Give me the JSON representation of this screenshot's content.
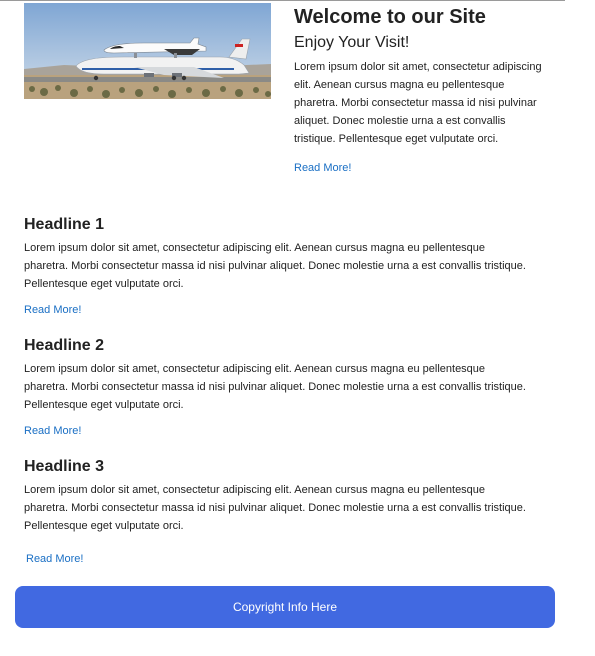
{
  "hero": {
    "image_alt": "Space shuttle on a carrier aircraft",
    "title": "Welcome to our Site",
    "subtitle": "Enjoy Your Visit!",
    "body": "Lorem ipsum dolor sit amet, consectetur adipiscing elit. Aenean cursus magna eu pellentesque pharetra. Morbi consectetur massa id nisi pulvinar aliquet. Donec molestie urna a est convallis tristique. Pellentesque eget vulputate orci.",
    "read_more": "Read More!"
  },
  "articles": [
    {
      "headline": "Headline 1",
      "body": "Lorem ipsum dolor sit amet, consectetur adipiscing elit. Aenean cursus magna eu pellentesque pharetra. Morbi consectetur massa id nisi pulvinar aliquet. Donec molestie urna a est convallis tristique. Pellentesque eget vulputate orci.",
      "read_more": "Read More!"
    },
    {
      "headline": "Headline 2",
      "body": "Lorem ipsum dolor sit amet, consectetur adipiscing elit. Aenean cursus magna eu pellentesque pharetra. Morbi consectetur massa id nisi pulvinar aliquet. Donec molestie urna a est convallis tristique. Pellentesque eget vulputate orci.",
      "read_more": "Read More!"
    },
    {
      "headline": "Headline 3",
      "body": "Lorem ipsum dolor sit amet, consectetur adipiscing elit. Aenean cursus magna eu pellentesque pharetra. Morbi consectetur massa id nisi pulvinar aliquet. Donec molestie urna a est convallis tristique. Pellentesque eget vulputate orci.",
      "read_more": "Read More!"
    }
  ],
  "footer": {
    "text": "Copyright Info Here"
  },
  "colors": {
    "link": "#1a6fc4",
    "footer_bg": "#4169e1",
    "footer_text": "#ffffff"
  }
}
